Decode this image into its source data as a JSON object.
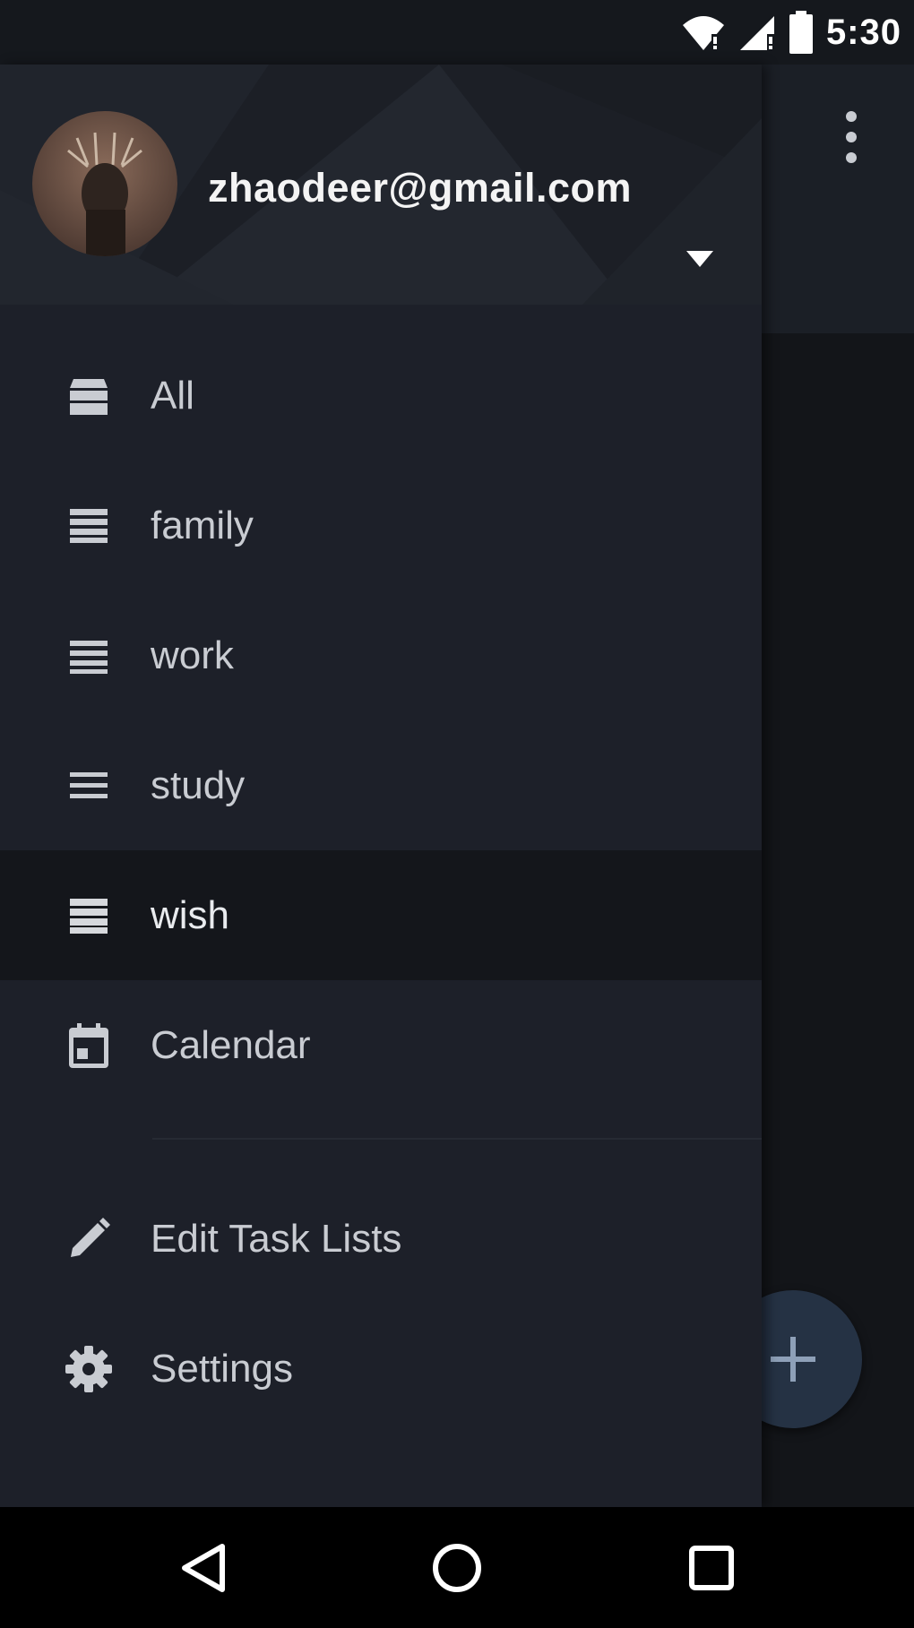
{
  "status_bar": {
    "time": "5:30"
  },
  "account": {
    "email": "zhaodeer@gmail.com"
  },
  "nav_items": [
    {
      "label": "All",
      "icon": "all-lists-icon"
    },
    {
      "label": "family",
      "icon": "list-icon"
    },
    {
      "label": "work",
      "icon": "list-icon"
    },
    {
      "label": "study",
      "icon": "list-icon"
    },
    {
      "label": "wish",
      "icon": "list-icon",
      "selected": true
    },
    {
      "label": "Calendar",
      "icon": "calendar-icon"
    }
  ],
  "actions": [
    {
      "label": "Edit Task Lists",
      "icon": "pencil-icon"
    },
    {
      "label": "Settings",
      "icon": "gear-icon"
    }
  ],
  "colors": {
    "drawer_bg": "#1d2029",
    "selected_bg": "#14161b",
    "fab_bg": "#253244",
    "text": "#c9ccd2"
  }
}
